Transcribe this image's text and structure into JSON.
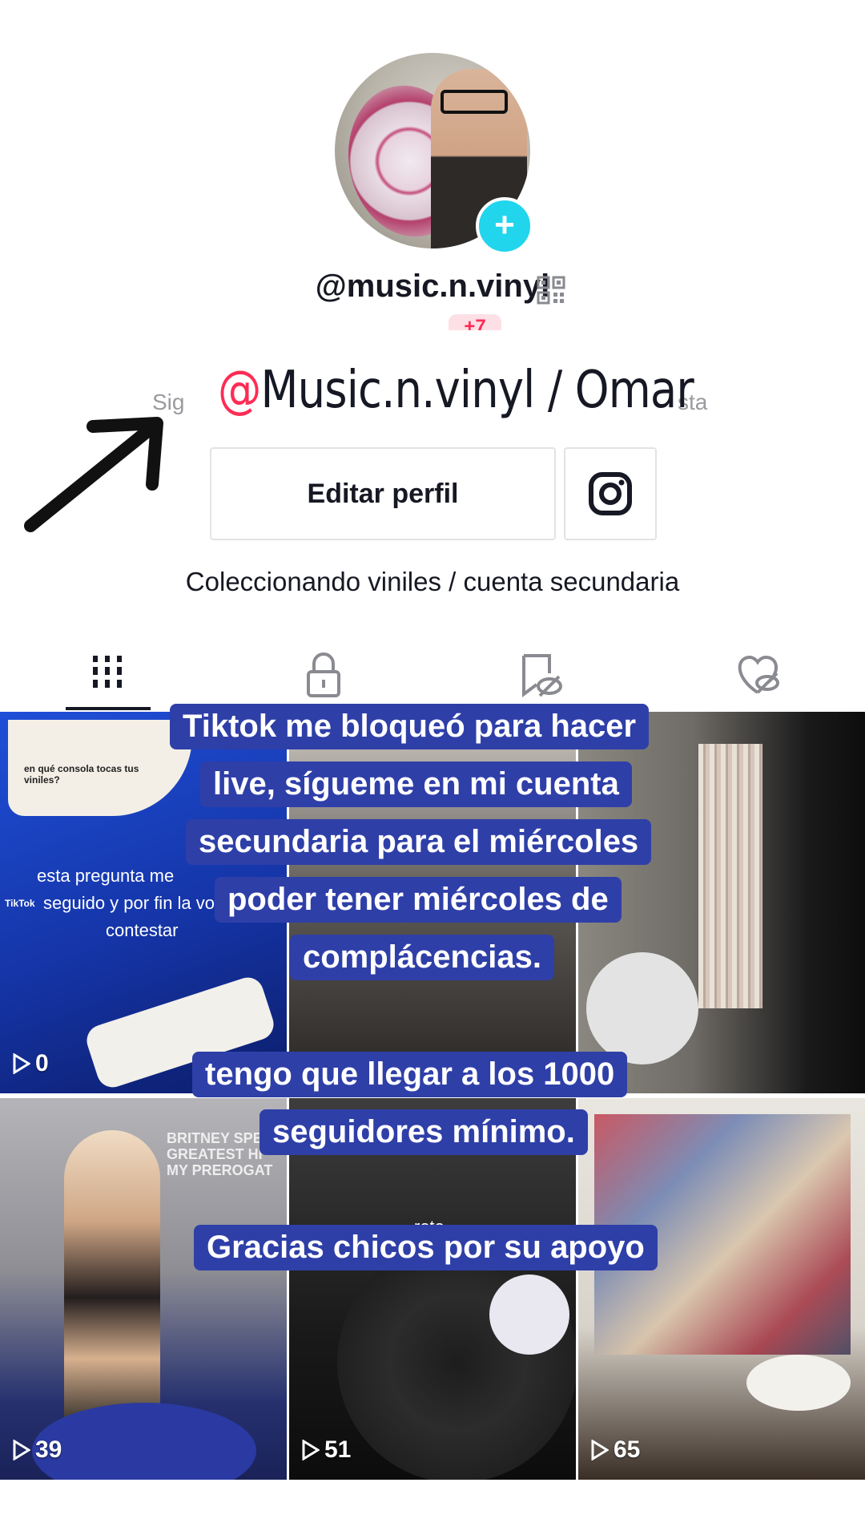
{
  "profile": {
    "username": "@music.n.vinyl",
    "follow_badge": "+7",
    "display_name_overlay": "Music.n.vinyl / Omar",
    "overlay_at": "@",
    "following_fragment": "Sig",
    "followers_fragment": "sta",
    "edit_button": "Editar perfil",
    "bio": "Coleccionando viniles / cuenta secundaria"
  },
  "tabs": [
    {
      "name": "videos",
      "icon": "grid-icon",
      "active": true
    },
    {
      "name": "private",
      "icon": "lock-icon",
      "active": false
    },
    {
      "name": "saved",
      "icon": "bookmark-hidden-icon",
      "active": false
    },
    {
      "name": "liked",
      "icon": "heart-hidden-icon",
      "active": false
    }
  ],
  "captions": {
    "line1": "Tiktok me bloqueó para hacer",
    "line2": "live, sígueme en mi cuenta",
    "line3": "secundaria para el miércoles",
    "line4": "poder tener miércoles de",
    "line5": "complácencias.",
    "line6": "tengo que llegar a los 1000",
    "line7": "seguidores mínimo.",
    "line8": "Gracias chicos por su apoyo"
  },
  "videos": [
    {
      "views": "0",
      "text_bubble_top": "en qué consola tocas tus viniles?",
      "text_lines": [
        "esta pregunta me",
        "seguido y por fin la vo",
        "contestar"
      ]
    },
    {
      "views": ""
    },
    {
      "views": ""
    },
    {
      "views": "39",
      "poster_text": "BRITNEY SPEA GREATEST HI MY PREROGAT"
    },
    {
      "views": "51",
      "overlay_text": "roto."
    },
    {
      "views": "65"
    }
  ],
  "watermark": "TikTok",
  "colors": {
    "accent": "#fe2c55",
    "caption_bg": "#2f3fa8",
    "badge": "#20d5ec"
  }
}
